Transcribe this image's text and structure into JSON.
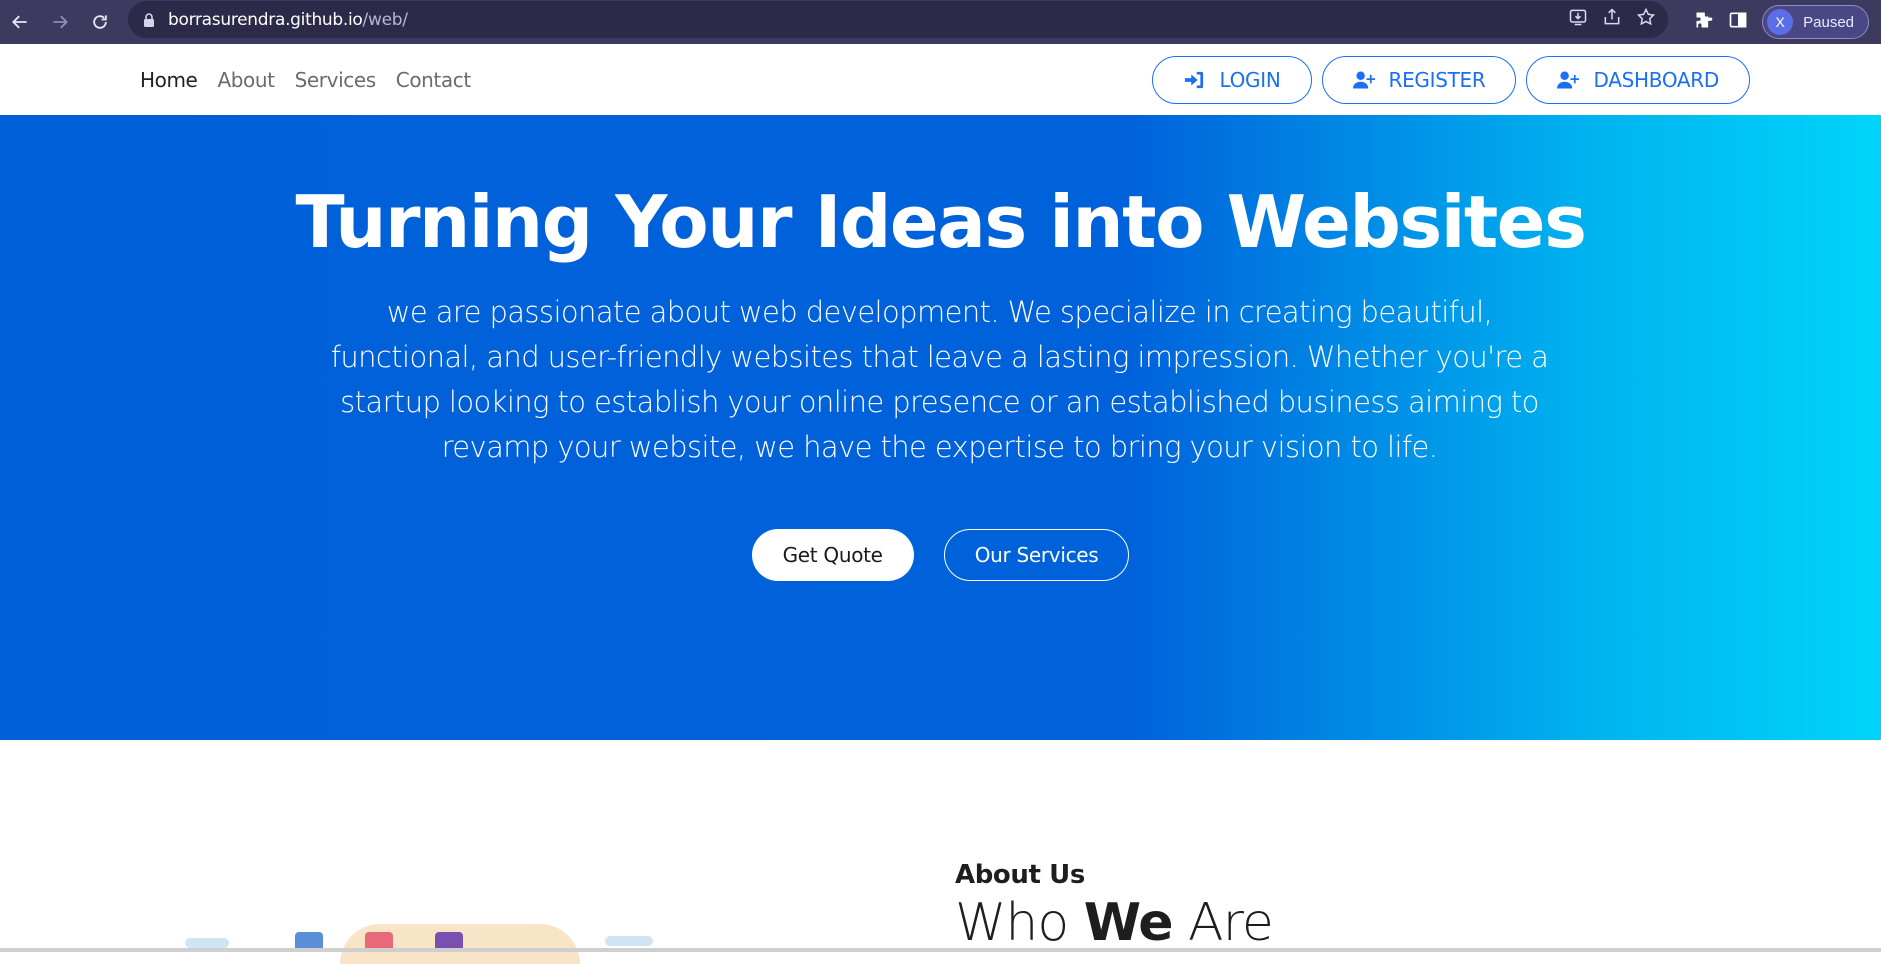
{
  "browser": {
    "url_host": "borrasurendra.github.io",
    "url_path": "/web/",
    "profile_initial": "X",
    "profile_status": "Paused"
  },
  "nav": {
    "links": [
      "Home",
      "About",
      "Services",
      "Contact"
    ],
    "login": "LOGIN",
    "register": "REGISTER",
    "dashboard": "DASHBOARD"
  },
  "hero": {
    "title": "Turning Your Ideas into Websites",
    "text": "we are passionate about web development. We specialize in creating beautiful, functional, and user-friendly websites that leave a lasting impression. Whether you're a startup looking to establish your online presence or an established business aiming to revamp your website, we have the expertise to bring your vision to life.",
    "get_quote": "Get Quote",
    "our_services": "Our Services"
  },
  "about": {
    "label": "About Us",
    "title_pre": "Who ",
    "title_bold": "We",
    "title_post": " Are"
  },
  "colors": {
    "accent": "#1a6ff5",
    "hero_start": "#0060d8",
    "hero_end": "#00d4fb",
    "chrome": "#3c3a5f"
  }
}
